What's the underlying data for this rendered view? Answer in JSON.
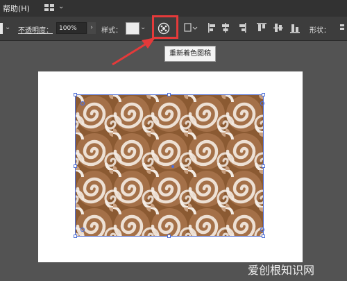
{
  "menubar": {
    "help_label": "帮助(H)",
    "workspace_icon": "grid-layout-icon",
    "workspace_chevron": "⌄"
  },
  "control_bar": {
    "opacity_label": "不透明度：",
    "opacity_value": "100%",
    "opacity_arrow": "›",
    "style_label": "样式：",
    "style_chevron": "⌄",
    "edge_chevron": "⌄",
    "recolor_icon": "recolor-artwork-icon",
    "shape_label": "形状：",
    "align_icons": [
      "transform-icon",
      "align-left-icon",
      "align-center-h-icon",
      "align-right-icon",
      "align-top-icon",
      "align-center-v-icon",
      "align-bottom-icon"
    ]
  },
  "tooltip": {
    "text": "重新着色图稿"
  },
  "colors": {
    "highlight": "#e53a3a",
    "selection": "#4f6fd6",
    "pattern_brown": "#8b5a32",
    "pattern_light": "#c9a080",
    "canvas": "#535353"
  },
  "watermark": {
    "text": "爱创根知识网"
  }
}
